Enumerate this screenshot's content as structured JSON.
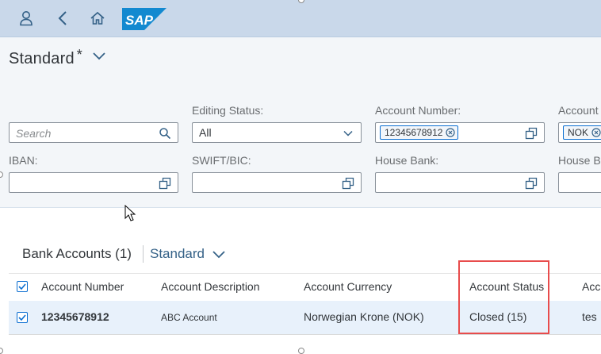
{
  "shell": {
    "logo_text": "SAP",
    "brand_color": "#008fd3",
    "icons": [
      "user-icon",
      "back-icon",
      "home-icon"
    ]
  },
  "header": {
    "variant_title": "Standard",
    "variant_dirty_marker": "*"
  },
  "filters": {
    "search_placeholder": "Search",
    "editing_status_label": "Editing Status:",
    "editing_status_value": "All",
    "account_number_label": "Account Number:",
    "account_number_token": "12345678912",
    "account_currency_label": "Account",
    "account_currency_token": "NOK",
    "iban_label": "IBAN:",
    "swift_label": "SWIFT/BIC:",
    "house_bank_label": "House Bank:",
    "house_bank_partial_label": "House B"
  },
  "table": {
    "title": "Bank Accounts (1)",
    "variant": "Standard",
    "columns": [
      "Account Number",
      "Account Description",
      "Account Currency",
      "Account Status",
      "Acc"
    ],
    "rows": [
      {
        "account_number": "12345678912",
        "description": "ABC Account",
        "currency": "Norwegian Krone (NOK)",
        "status": "Closed (15)",
        "extra": "tes"
      }
    ]
  },
  "colors": {
    "shell_bg": "#c9d8ea",
    "header_bg": "#f3f6f9",
    "selected_row": "#e8f1fb",
    "accent": "#0a6ed1",
    "highlight_border": "#e84c4c"
  }
}
